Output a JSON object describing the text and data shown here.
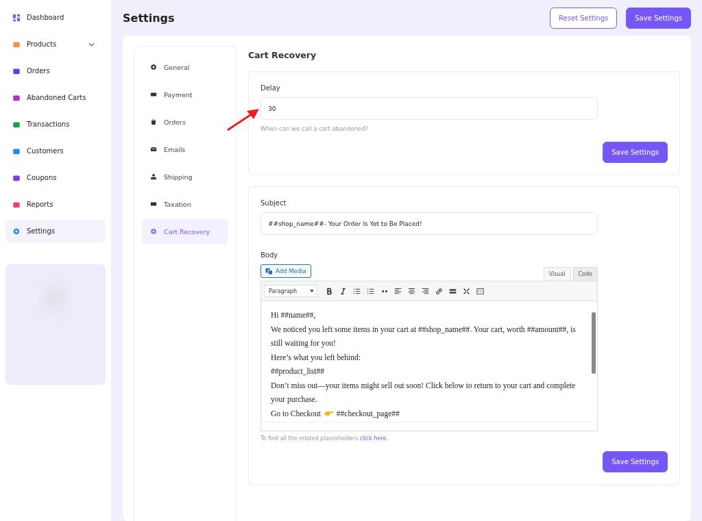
{
  "sidebar": {
    "items": [
      {
        "label": "Dashboard",
        "selected": false,
        "expandable": false
      },
      {
        "label": "Products",
        "selected": false,
        "expandable": true
      },
      {
        "label": "Orders",
        "selected": false,
        "expandable": false
      },
      {
        "label": "Abandoned Carts",
        "selected": false,
        "expandable": false
      },
      {
        "label": "Transactions",
        "selected": false,
        "expandable": false
      },
      {
        "label": "Customers",
        "selected": false,
        "expandable": false
      },
      {
        "label": "Coupons",
        "selected": false,
        "expandable": false
      },
      {
        "label": "Reports",
        "selected": false,
        "expandable": false
      },
      {
        "label": "Settings",
        "selected": true,
        "expandable": false
      }
    ]
  },
  "header": {
    "title": "Settings",
    "buttons": [
      {
        "label": "Reset Settings",
        "kind": "outline"
      },
      {
        "label": "Save Settings",
        "kind": "primary"
      }
    ]
  },
  "settings_nav": {
    "items": [
      {
        "label": "General",
        "selected": false
      },
      {
        "label": "Payment",
        "selected": false
      },
      {
        "label": "Orders",
        "selected": false
      },
      {
        "label": "Emails",
        "selected": false
      },
      {
        "label": "Shipping",
        "selected": false
      },
      {
        "label": "Taxation",
        "selected": false
      },
      {
        "label": "Cart Recovery",
        "selected": true
      }
    ]
  },
  "section_title": "Cart Recovery",
  "delay_card": {
    "label": "Delay",
    "value": "30",
    "help": "When can we call a cart abandoned?",
    "button": "Save Settings"
  },
  "email_card": {
    "subject_label": "Subject",
    "subject_value": "##shop_name##- Your Order Is Yet to Be Placed!",
    "body_label": "Body",
    "add_media": "Add Media",
    "editor_tabs": [
      {
        "label": "Visual",
        "selected": true
      },
      {
        "label": "Code",
        "selected": false
      }
    ],
    "format": "Paragraph",
    "body_lines": [
      "Hi ##name##,",
      "We noticed you left some items in your cart at ##shop_name##. Your cart, worth ##amount##, is still waiting for you!",
      "Here’s what you left behind:",
      "##product_list##",
      "Don’t miss out—your items might sell out soon! Click below to return to your cart and complete your purchase."
    ],
    "checkout_line": {
      "before": "Go to Checkout",
      "after": "##checkout_page##"
    },
    "hint": "To find all the related placesholders",
    "hint_link": "click here.",
    "button": "Save Settings"
  }
}
